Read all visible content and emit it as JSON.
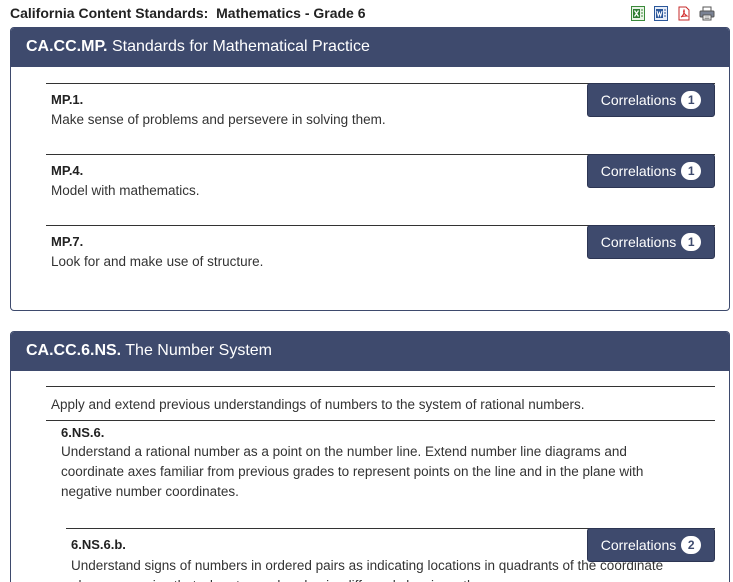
{
  "page_title": "California Content Standards:  Mathematics - Grade 6",
  "export_icons": [
    "excel-icon",
    "word-icon",
    "pdf-icon",
    "print-icon"
  ],
  "panels": [
    {
      "code": "CA.CC.MP.",
      "title": "Standards for Mathematical Practice",
      "standards": [
        {
          "code": "MP.1.",
          "text": "Make sense of problems and persevere in solving them.",
          "button": "Correlations",
          "count": "1"
        },
        {
          "code": "MP.4.",
          "text": "Model with mathematics.",
          "button": "Correlations",
          "count": "1"
        },
        {
          "code": "MP.7.",
          "text": "Look for and make use of structure.",
          "button": "Correlations",
          "count": "1"
        }
      ]
    },
    {
      "code": "CA.CC.6.NS.",
      "title": "The Number System",
      "cluster": "Apply and extend previous understandings of numbers to the system of rational numbers.",
      "standard": {
        "code": "6.NS.6.",
        "text": "Understand a rational number as a point on the number line. Extend number line diagrams and coordinate axes familiar from previous grades to represent points on the line and in the plane with negative number coordinates."
      },
      "substandard": {
        "code": "6.NS.6.b.",
        "text": "Understand signs of numbers in ordered pairs as indicating locations in quadrants of the coordinate plane; recognize that when two ordered pairs differ only by signs, the",
        "button": "Correlations",
        "count": "2"
      }
    }
  ]
}
